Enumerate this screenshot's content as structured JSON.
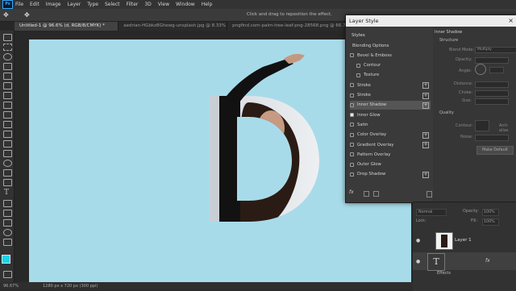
{
  "app": {
    "logo": "Ps"
  },
  "menu": [
    "File",
    "Edit",
    "Image",
    "Layer",
    "Type",
    "Select",
    "Filter",
    "3D",
    "View",
    "Window",
    "Help"
  ],
  "options": {
    "move_tool_icon": "move-icon",
    "hint": "Click and drag to reposition the effect."
  },
  "tabs": [
    {
      "label": "Untitled-1 @ 96.6% (d, RGB/8/CMYK) *",
      "active": true
    },
    {
      "label": "aedrian-HGbkz8Ghewg-unsplash.jpg @ 8.33% (RGB/8)",
      "active": false
    },
    {
      "label": "pngfind.com-palm-tree-leaf-png-28568.png @ 66.7% (Layer",
      "active": false
    }
  ],
  "status": {
    "zoom": "96.67%",
    "size": "1280 px x 720 px (300 ppi)"
  },
  "canvas": {
    "background": "#a8dbe9",
    "letter": "D"
  },
  "dialog": {
    "title": "Layer Style",
    "styles_header": "Styles",
    "items": [
      {
        "label": "Blending Options",
        "checkbox": false,
        "plus": false,
        "selected": false,
        "indent": false
      },
      {
        "label": "Bevel & Emboss",
        "checkbox": true,
        "checked": false,
        "plus": false,
        "selected": false,
        "indent": false
      },
      {
        "label": "Contour",
        "checkbox": true,
        "checked": false,
        "plus": false,
        "selected": false,
        "indent": true
      },
      {
        "label": "Texture",
        "checkbox": true,
        "checked": false,
        "plus": false,
        "selected": false,
        "indent": true
      },
      {
        "label": "Stroke",
        "checkbox": true,
        "checked": false,
        "plus": true,
        "selected": false,
        "indent": false
      },
      {
        "label": "Stroke",
        "checkbox": true,
        "checked": false,
        "plus": true,
        "selected": false,
        "indent": false
      },
      {
        "label": "Inner Shadow",
        "checkbox": true,
        "checked": false,
        "plus": true,
        "selected": true,
        "indent": false
      },
      {
        "label": "Inner Glow",
        "checkbox": true,
        "checked": true,
        "plus": false,
        "selected": false,
        "indent": false
      },
      {
        "label": "Satin",
        "checkbox": true,
        "checked": false,
        "plus": false,
        "selected": false,
        "indent": false
      },
      {
        "label": "Color Overlay",
        "checkbox": true,
        "checked": false,
        "plus": true,
        "selected": false,
        "indent": false
      },
      {
        "label": "Gradient Overlay",
        "checkbox": true,
        "checked": false,
        "plus": true,
        "selected": false,
        "indent": false
      },
      {
        "label": "Pattern Overlay",
        "checkbox": true,
        "checked": false,
        "plus": false,
        "selected": false,
        "indent": false
      },
      {
        "label": "Outer Glow",
        "checkbox": true,
        "checked": false,
        "plus": false,
        "selected": false,
        "indent": false
      },
      {
        "label": "Drop Shadow",
        "checkbox": true,
        "checked": false,
        "plus": true,
        "selected": false,
        "indent": false
      }
    ],
    "footer_fx": "fx",
    "right": {
      "section": "Inner Shadow",
      "structure": "Structure",
      "blend_mode_label": "Blend Mode:",
      "blend_mode": "Multiply",
      "opacity_label": "Opacity:",
      "angle_label": "Angle:",
      "distance_label": "Distance:",
      "choke_label": "Choke:",
      "size_label": "Size:",
      "quality": "Quality",
      "contour_label": "Contour:",
      "antialias_label": "Anti-alias",
      "noise_label": "Noise:",
      "default_button": "Make Default"
    }
  },
  "layers": {
    "mode": "Normal",
    "opacity_label": "Opacity:",
    "opacity": "100%",
    "lock_label": "Lock:",
    "fill_label": "Fill:",
    "fill": "100%",
    "items": [
      {
        "name": "Layer 1",
        "type": "image"
      },
      {
        "name": "T",
        "type": "text",
        "fx": "fx"
      }
    ],
    "effects_label": "Effects"
  }
}
